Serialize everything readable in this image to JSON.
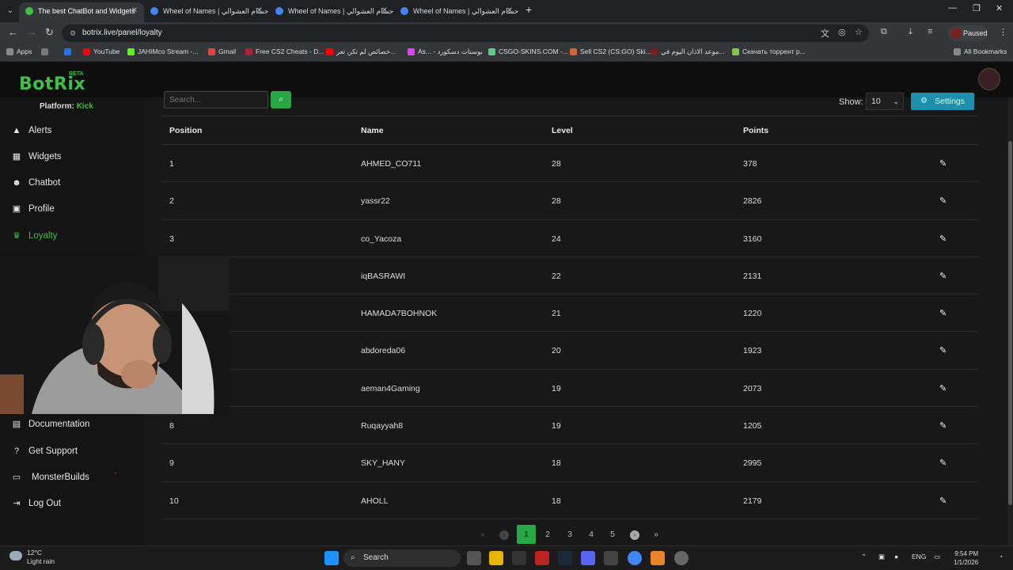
{
  "browser": {
    "tabs": [
      {
        "title": "The best ChatBot and Widgets",
        "active": true,
        "favicon_color": "#3fbf45"
      },
      {
        "title": "Wheel of Names | حسام العشوالي",
        "active": false,
        "favicon_color": "#4285f4"
      },
      {
        "title": "Wheel of Names | حسام العشوالي",
        "active": false,
        "favicon_color": "#4285f4"
      },
      {
        "title": "Wheel of Names | حسام العشوالي",
        "active": false,
        "favicon_color": "#4285f4"
      }
    ],
    "url": "botrix.live/panel/loyalty",
    "profile_status": "Paused",
    "bookmarks": [
      {
        "label": "Apps",
        "color": "#888"
      },
      {
        "label": "",
        "color": "#1877f2"
      },
      {
        "label": "YouTube",
        "color": "#ff0000"
      },
      {
        "label": "JAHIMco Stream -...",
        "color": "#53fc18"
      },
      {
        "label": "Gmail",
        "color": "#ea4335"
      },
      {
        "label": "Free CS2 Cheats - D...",
        "color": "#aa2233"
      },
      {
        "label": "خصائص لم تكن تعر...",
        "color": "#ff0000"
      },
      {
        "label": "As... - بوستات دسكورد",
        "color": "#e040fb"
      },
      {
        "label": "CSGO-SKINS.COM -...",
        "color": "#5c8"
      },
      {
        "label": "Sell CS2 (CS:GO) Ski...",
        "color": "#c63"
      },
      {
        "label": "موعد الاذان اليوم في...",
        "color": "#7a1f1f"
      },
      {
        "label": "Скачать торрент р...",
        "color": "#7c4"
      }
    ],
    "all_bookmarks": "All Bookmarks"
  },
  "app": {
    "logo": "BotRix",
    "beta": "BETA",
    "platform_label": "Platform:",
    "platform_value": "Kick",
    "nav": [
      {
        "label": "Alerts",
        "icon": "warning-icon",
        "glyph": "▲",
        "active": false
      },
      {
        "label": "Widgets",
        "icon": "grid-icon",
        "glyph": "▦",
        "active": false
      },
      {
        "label": "Chatbot",
        "icon": "robot-icon",
        "glyph": "☻",
        "active": false
      },
      {
        "label": "Profile",
        "icon": "id-card-icon",
        "glyph": "▣",
        "active": false
      },
      {
        "label": "Loyalty",
        "icon": "trophy-icon",
        "glyph": "♛",
        "active": true
      }
    ],
    "nav_bottom": [
      {
        "label": "Documentation",
        "icon": "book-icon",
        "glyph": "▤"
      },
      {
        "label": "Get Support",
        "icon": "question-icon",
        "glyph": "?"
      },
      {
        "label": "MonsterBuilds",
        "icon": "laptop-icon",
        "glyph": "▭"
      },
      {
        "label": "Log Out",
        "icon": "logout-icon",
        "glyph": "⇥"
      }
    ]
  },
  "loyalty": {
    "search_placeholder": "Search...",
    "show_label": "Show:",
    "show_value": "10",
    "settings_label": "Settings",
    "columns": [
      "Position",
      "Name",
      "Level",
      "Points"
    ],
    "rows": [
      {
        "position": "1",
        "name": "AHMED_CO711",
        "level": "28",
        "points": "378"
      },
      {
        "position": "2",
        "name": "yassr22",
        "level": "28",
        "points": "2826"
      },
      {
        "position": "3",
        "name": "co_Yacoza",
        "level": "24",
        "points": "3160"
      },
      {
        "position": "",
        "name": "iqBASRAWI",
        "level": "22",
        "points": "2131"
      },
      {
        "position": "",
        "name": "HAMADA7BOHNOK",
        "level": "21",
        "points": "1220"
      },
      {
        "position": "",
        "name": "abdoreda06",
        "level": "20",
        "points": "1923"
      },
      {
        "position": "",
        "name": "aeman4Gaming",
        "level": "19",
        "points": "2073"
      },
      {
        "position": "8",
        "name": "Ruqayyah8",
        "level": "19",
        "points": "1205"
      },
      {
        "position": "9",
        "name": "SKY_HANY",
        "level": "18",
        "points": "2995"
      },
      {
        "position": "10",
        "name": "AHOLL",
        "level": "18",
        "points": "2179"
      }
    ],
    "pages": [
      "1",
      "2",
      "3",
      "4",
      "5"
    ],
    "current_page": "1"
  },
  "taskbar": {
    "temperature": "12°C",
    "weather": "Light rain",
    "search": "Search",
    "lang": "ENG",
    "time": "9:54 PM",
    "date": "1/1/2026"
  }
}
